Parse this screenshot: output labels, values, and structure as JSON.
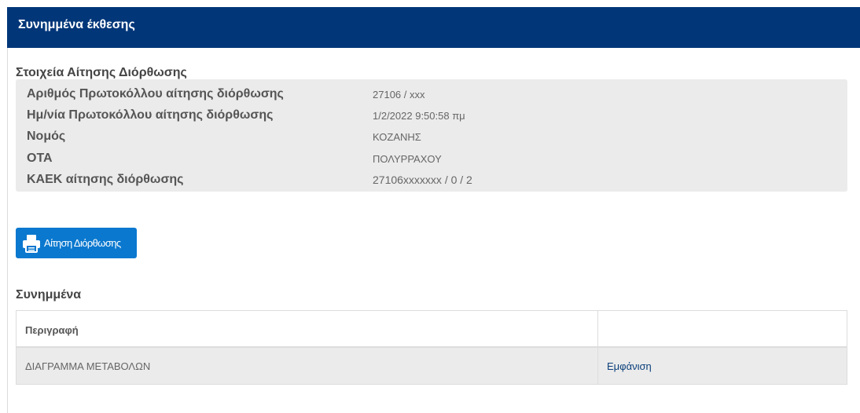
{
  "panel": {
    "title": "Συνημμένα έκθεσης"
  },
  "details_section": {
    "title": "Στοιχεία Αίτησης Διόρθωσης",
    "rows": [
      {
        "label": "Αριθμός Πρωτοκόλλου αίτησης διόρθωσης",
        "value": "27106 / xxx"
      },
      {
        "label": "Ημ/νία Πρωτοκόλλου αίτησης διόρθωσης",
        "value": "1/2/2022 9:50:58 πμ"
      },
      {
        "label": "Νομός",
        "value": "ΚΟΖΑΝΗΣ"
      },
      {
        "label": "ΟΤΑ",
        "value": "ΠΟΛΥΡΡΑΧΟΥ"
      },
      {
        "label": "ΚΑΕΚ αίτησης διόρθωσης",
        "value": "27106xxxxxxx / 0 / 2"
      }
    ]
  },
  "print_button": {
    "label": "Αίτηση Διόρθωσης",
    "icon": "printer-icon"
  },
  "attachments_section": {
    "title": "Συνημμένα",
    "table": {
      "headers": [
        "Περιγραφή",
        ""
      ],
      "rows": [
        {
          "description": "ΔΙΑΓΡΑΜΜΑ ΜΕΤΑΒΟΛΩΝ",
          "action": "Εμφάνιση"
        }
      ]
    }
  },
  "colors": {
    "header_bg": "#013679",
    "button_bg": "#0a78cf",
    "row_bg": "#ebebeb",
    "link": "#0b3f7a"
  }
}
